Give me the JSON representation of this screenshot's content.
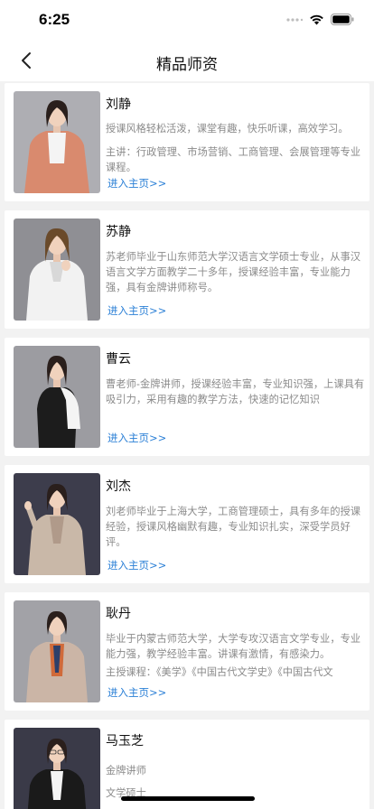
{
  "status": {
    "time": "6:25"
  },
  "nav": {
    "title": "精品师资"
  },
  "teachers": [
    {
      "name": "刘静",
      "desc": "授课风格轻松活泼，课堂有趣，快乐听课，高效学习。",
      "extra": "主讲：行政管理、市场营销、工商管理、会展管理等专业课程。",
      "link": "进入主页>>",
      "outfit": "#d98a6e",
      "bg": "#a9a9ae"
    },
    {
      "name": "苏静",
      "desc": "苏老师毕业于山东师范大学汉语言文学硕士专业，从事汉语言文学方面教学二十多年，授课经验丰富，专业能力强，具有金牌讲师称号。",
      "extra": "",
      "link": "进入主页>>",
      "outfit": "#f0f0f0",
      "bg": "#8d8d92"
    },
    {
      "name": "曹云",
      "desc": "曹老师-金牌讲师，授课经验丰富，专业知识强，上课具有吸引力，采用有趣的教学方法，快速的记忆知识",
      "extra": "",
      "link": "进入主页>>",
      "outfit": "#1c1c1c",
      "bg": "#9a9a9f"
    },
    {
      "name": "刘杰",
      "desc": "刘老师毕业于上海大学，工商管理硕士，具有多年的授课经验，授课风格幽默有趣，专业知识扎实，深受学员好评。",
      "extra": "",
      "link": "进入主页>>",
      "outfit": "#c9b8a8",
      "bg": "#3b3b4a"
    },
    {
      "name": "耿丹",
      "desc": "毕业于内蒙古师范大学，大学专攻汉语言文学专业，专业能力强，教学经验丰富。讲课有激情，有感染力。",
      "extra": "主授课程：《美学》《中国古代文学史》《中国古代文",
      "link": "进入主页>>",
      "outfit": "#cbb5a6",
      "bg": "#9e9ea3"
    },
    {
      "name": "马玉芝",
      "desc": "金牌讲师",
      "extra": "文学硕士",
      "link": "",
      "outfit": "#1a1a1a",
      "bg": "#3a3a48"
    }
  ]
}
